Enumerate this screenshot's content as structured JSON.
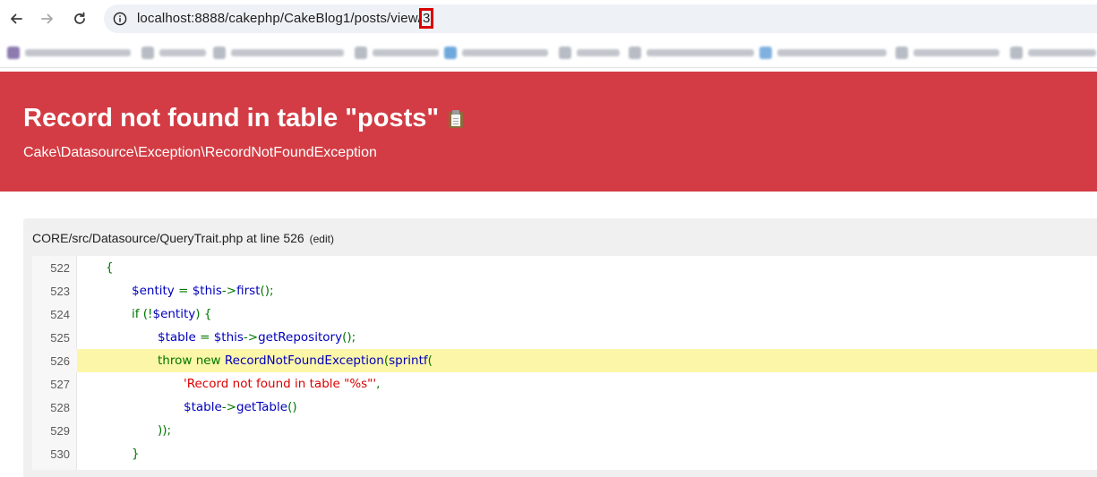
{
  "browser": {
    "url_prefix": "localhost:8888/cakephp/CakeBlog1/posts/view/",
    "url_highlight": "3",
    "bookmarks_count_note": ""
  },
  "error": {
    "title": "Record not found in table \"posts\"",
    "exception_class": "Cake\\Datasource\\Exception\\RecordNotFoundException",
    "header_color": "#d33c44"
  },
  "frame": {
    "location": "CORE/src/Datasource/QueryTrait.php at line 526",
    "edit_label": "(edit)",
    "active_line": 526,
    "lines": [
      {
        "no": "522",
        "indent": 0,
        "tokens": [
          {
            "t": "{",
            "c": "kw"
          }
        ]
      },
      {
        "no": "523",
        "indent": 1,
        "tokens": [
          {
            "t": "$entity",
            "c": "var"
          },
          {
            "t": " = ",
            "c": "kw"
          },
          {
            "t": "$this",
            "c": "var"
          },
          {
            "t": "->",
            "c": "kw"
          },
          {
            "t": "first",
            "c": "var"
          },
          {
            "t": "();",
            "c": "kw"
          }
        ]
      },
      {
        "no": "524",
        "indent": 1,
        "tokens": [
          {
            "t": "if (!",
            "c": "kw"
          },
          {
            "t": "$entity",
            "c": "var"
          },
          {
            "t": ") {",
            "c": "kw"
          }
        ]
      },
      {
        "no": "525",
        "indent": 2,
        "tokens": [
          {
            "t": "$table",
            "c": "var"
          },
          {
            "t": " = ",
            "c": "kw"
          },
          {
            "t": "$this",
            "c": "var"
          },
          {
            "t": "->",
            "c": "kw"
          },
          {
            "t": "getRepository",
            "c": "var"
          },
          {
            "t": "();",
            "c": "kw"
          }
        ]
      },
      {
        "no": "526",
        "indent": 2,
        "tokens": [
          {
            "t": "throw new ",
            "c": "kw"
          },
          {
            "t": "RecordNotFoundException",
            "c": "var"
          },
          {
            "t": "(",
            "c": "kw"
          },
          {
            "t": "sprintf",
            "c": "var"
          },
          {
            "t": "(",
            "c": "kw"
          }
        ]
      },
      {
        "no": "527",
        "indent": 3,
        "tokens": [
          {
            "t": "'Record not found in table \"%s\"'",
            "c": "str"
          },
          {
            "t": ",",
            "c": "kw"
          }
        ]
      },
      {
        "no": "528",
        "indent": 3,
        "tokens": [
          {
            "t": "$table",
            "c": "var"
          },
          {
            "t": "->",
            "c": "kw"
          },
          {
            "t": "getTable",
            "c": "var"
          },
          {
            "t": "()",
            "c": "kw"
          }
        ]
      },
      {
        "no": "529",
        "indent": 2,
        "tokens": [
          {
            "t": "));",
            "c": "kw"
          }
        ]
      },
      {
        "no": "530",
        "indent": 1,
        "tokens": [
          {
            "t": "}",
            "c": "kw"
          }
        ]
      }
    ]
  },
  "colors": {
    "keyword": "#007700",
    "variable": "#0000bb",
    "string": "#dd0000",
    "highlight_line": "#fcf6a8"
  }
}
